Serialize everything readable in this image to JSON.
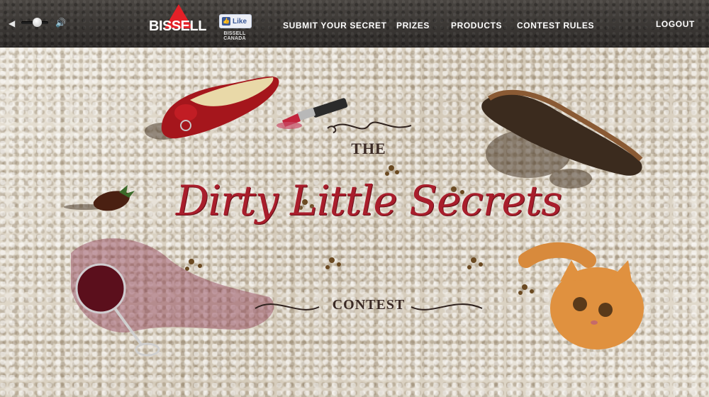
{
  "volume": {
    "level": 0.6
  },
  "logo": {
    "text": "BISSELL"
  },
  "facebook": {
    "button_label": "Like",
    "caption": "BISSELL CANADA",
    "thumb": "👍"
  },
  "nav": {
    "submit": "SUBMIT YOUR SECRET",
    "prizes": "PRIZES",
    "products": "PRODUCTS",
    "rules": "CONTEST RULES",
    "logout": "LOGOUT"
  },
  "hero": {
    "the": "THE",
    "title": "Dirty Little Secrets",
    "contest": "CONTEST"
  },
  "colors": {
    "brand_red": "#e32027",
    "title_red": "#a91e2c",
    "bar": "#3a3633"
  }
}
